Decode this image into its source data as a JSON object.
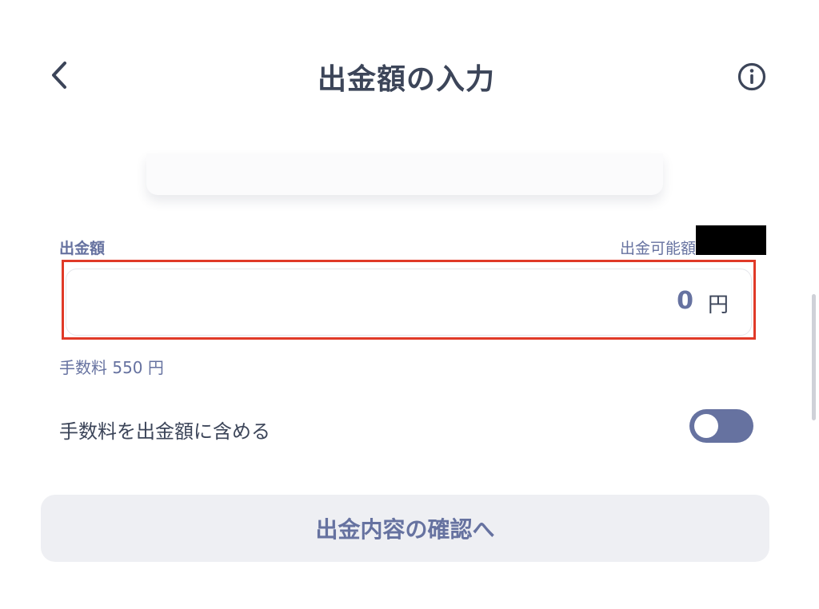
{
  "header": {
    "title": "出金額の入力",
    "back_icon": "chevron-left-icon",
    "info_icon": "info-circle-icon"
  },
  "amount_section": {
    "label": "出金額",
    "available_label": "出金可能額",
    "value": "0",
    "unit": "円",
    "fee_note": "手数料 550 円"
  },
  "fee_toggle": {
    "label": "手数料を出金額に含める",
    "state": "off"
  },
  "confirm_button": {
    "label": "出金内容の確認へ"
  },
  "colors": {
    "text_primary": "#3c4559",
    "accent": "#6672a0",
    "highlight": "#e03a28",
    "button_bg": "#eeeff3"
  }
}
